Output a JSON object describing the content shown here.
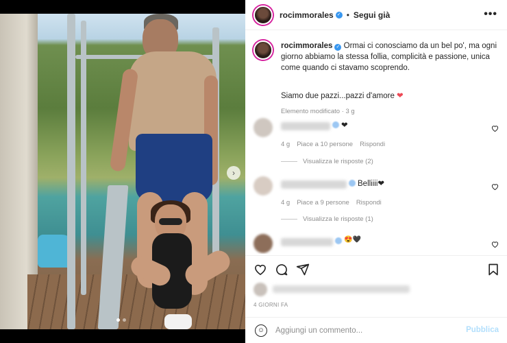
{
  "post": {
    "username": "rocimmorales",
    "follow_label": "Segui già",
    "separator": "•",
    "more_label": "•••"
  },
  "caption": {
    "username": "rocimmorales",
    "text": "Ormai ci conosciamo da un bel po', ma ogni giorno abbiamo la stessa follia, complicità e passione, unica come quando ci stavamo scoprendo.",
    "line2": "Siamo due pazzi...pazzi d'amore",
    "heart": "❤",
    "edited": "Elemento modificato · 3 g"
  },
  "comments": [
    {
      "text": "❤",
      "age": "4 g",
      "likes": "Piace a 10 persone",
      "reply": "Rispondi",
      "replies": "Visualizza le risposte (2)"
    },
    {
      "text": "Belliiii❤",
      "age": "4 g",
      "likes": "Piace a 9 persone",
      "reply": "Rispondi",
      "replies": "Visualizza le risposte (1)"
    },
    {
      "text": "😍🖤"
    }
  ],
  "date": "4 GIORNI FA",
  "composer": {
    "placeholder": "Aggiungi un commento...",
    "publish_label": "Pubblica"
  },
  "colors": {
    "accent": "#3897f0",
    "heart": "#ed4956",
    "publish_disabled": "#b2dffc"
  }
}
